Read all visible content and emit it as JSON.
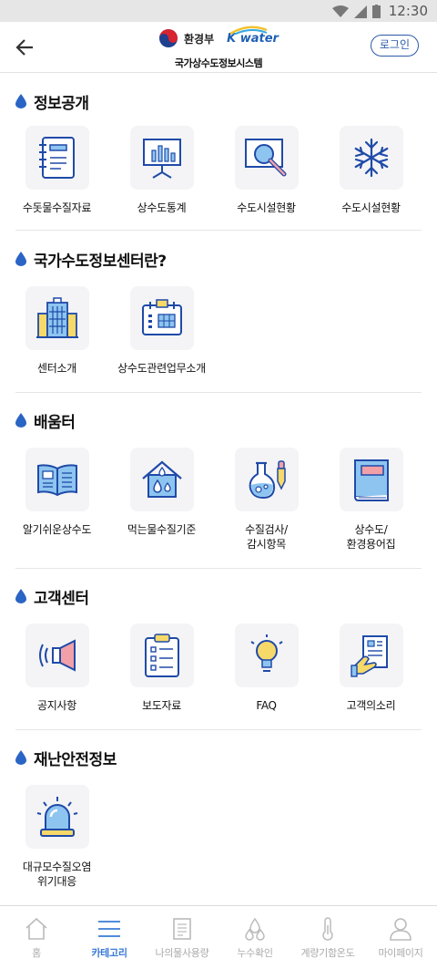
{
  "status_bar": {
    "time": "12:30"
  },
  "header": {
    "ministry": "환경부",
    "brand": "K water",
    "site_name": "국가상수도정보시스템",
    "login_label": "로그인"
  },
  "sections": [
    {
      "title": "정보공개",
      "items": [
        {
          "label": "수돗물수질자료",
          "icon": "notebook-icon"
        },
        {
          "label": "상수도통계",
          "icon": "bar-chart-board-icon"
        },
        {
          "label": "수도시설현황",
          "icon": "magnifier-icon"
        },
        {
          "label": "수도시설현황",
          "icon": "snowflake-icon"
        }
      ]
    },
    {
      "title": "국가수도정보센터란?",
      "items": [
        {
          "label": "센터소개",
          "icon": "building-icon"
        },
        {
          "label": "상수도관련업무소개",
          "icon": "calendar-icon"
        }
      ]
    },
    {
      "title": "배움터",
      "items": [
        {
          "label": "알기쉬운상수도",
          "icon": "open-book-icon"
        },
        {
          "label": "먹는물수질기준",
          "icon": "house-water-icon"
        },
        {
          "label": "수질검사/\n감시항목",
          "icon": "flask-dropper-icon"
        },
        {
          "label": "상수도/\n환경용어집",
          "icon": "closed-book-icon"
        }
      ]
    },
    {
      "title": "고객센터",
      "items": [
        {
          "label": "공지사항",
          "icon": "megaphone-icon"
        },
        {
          "label": "보도자료",
          "icon": "clipboard-icon"
        },
        {
          "label": "FAQ",
          "icon": "lightbulb-icon"
        },
        {
          "label": "고객의소리",
          "icon": "hand-document-icon"
        }
      ]
    },
    {
      "title": "재난안전정보",
      "items": [
        {
          "label": "대규모수질오염\n위기대응",
          "icon": "siren-icon"
        }
      ]
    }
  ],
  "bottom_nav": [
    {
      "label": "홈",
      "icon": "home-icon",
      "active": false
    },
    {
      "label": "카테고리",
      "icon": "menu-icon",
      "active": true
    },
    {
      "label": "나의물사용량",
      "icon": "document-icon",
      "active": false
    },
    {
      "label": "누수확인",
      "icon": "water-drops-icon",
      "active": false
    },
    {
      "label": "계량기함온도",
      "icon": "thermometer-icon",
      "active": false
    },
    {
      "label": "마이페이지",
      "icon": "person-icon",
      "active": false
    }
  ],
  "colors": {
    "accent": "#3a7bd5",
    "icon_blue": "#1f4aa8",
    "icon_light_blue": "#8ec5f0",
    "icon_pink": "#f2a0a8",
    "icon_yellow": "#f7d96a",
    "login_border": "#2b5aa8"
  }
}
